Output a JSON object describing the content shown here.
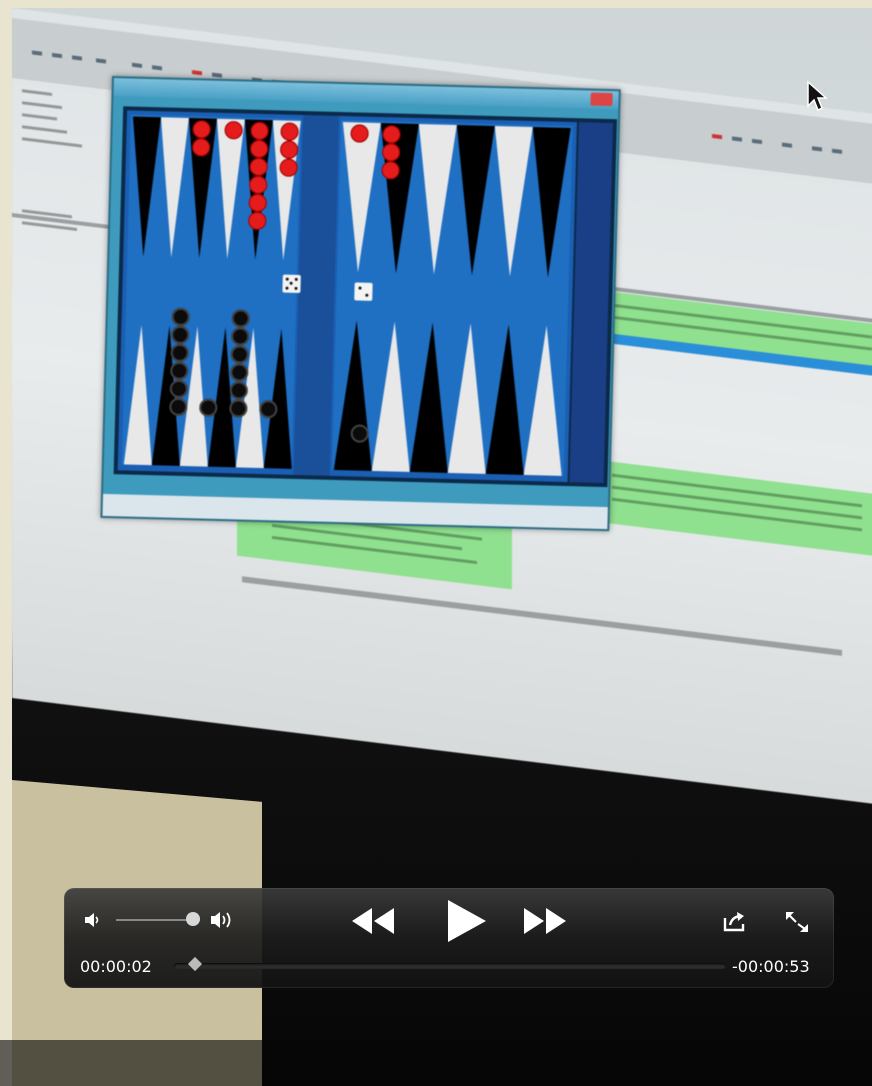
{
  "player": {
    "elapsed": "00:00:02",
    "remaining": "-00:00:53",
    "progress_fraction": 0.036,
    "volume_fraction": 0.85,
    "icons": {
      "volume_low": "speaker-low-icon",
      "volume_high": "speaker-high-icon",
      "rewind": "rewind-icon",
      "play": "play-icon",
      "fast_forward": "fast-forward-icon",
      "share": "share-icon",
      "fullscreen": "fullscreen-icon"
    }
  },
  "colors": {
    "hud_bg": "#1e1e1e",
    "hud_text": "#ffffff",
    "board_blue": "#1f6fc2",
    "checker_red": "#e61c1c",
    "checker_black": "#0b0b0b",
    "code_green": "#8fe08f"
  }
}
